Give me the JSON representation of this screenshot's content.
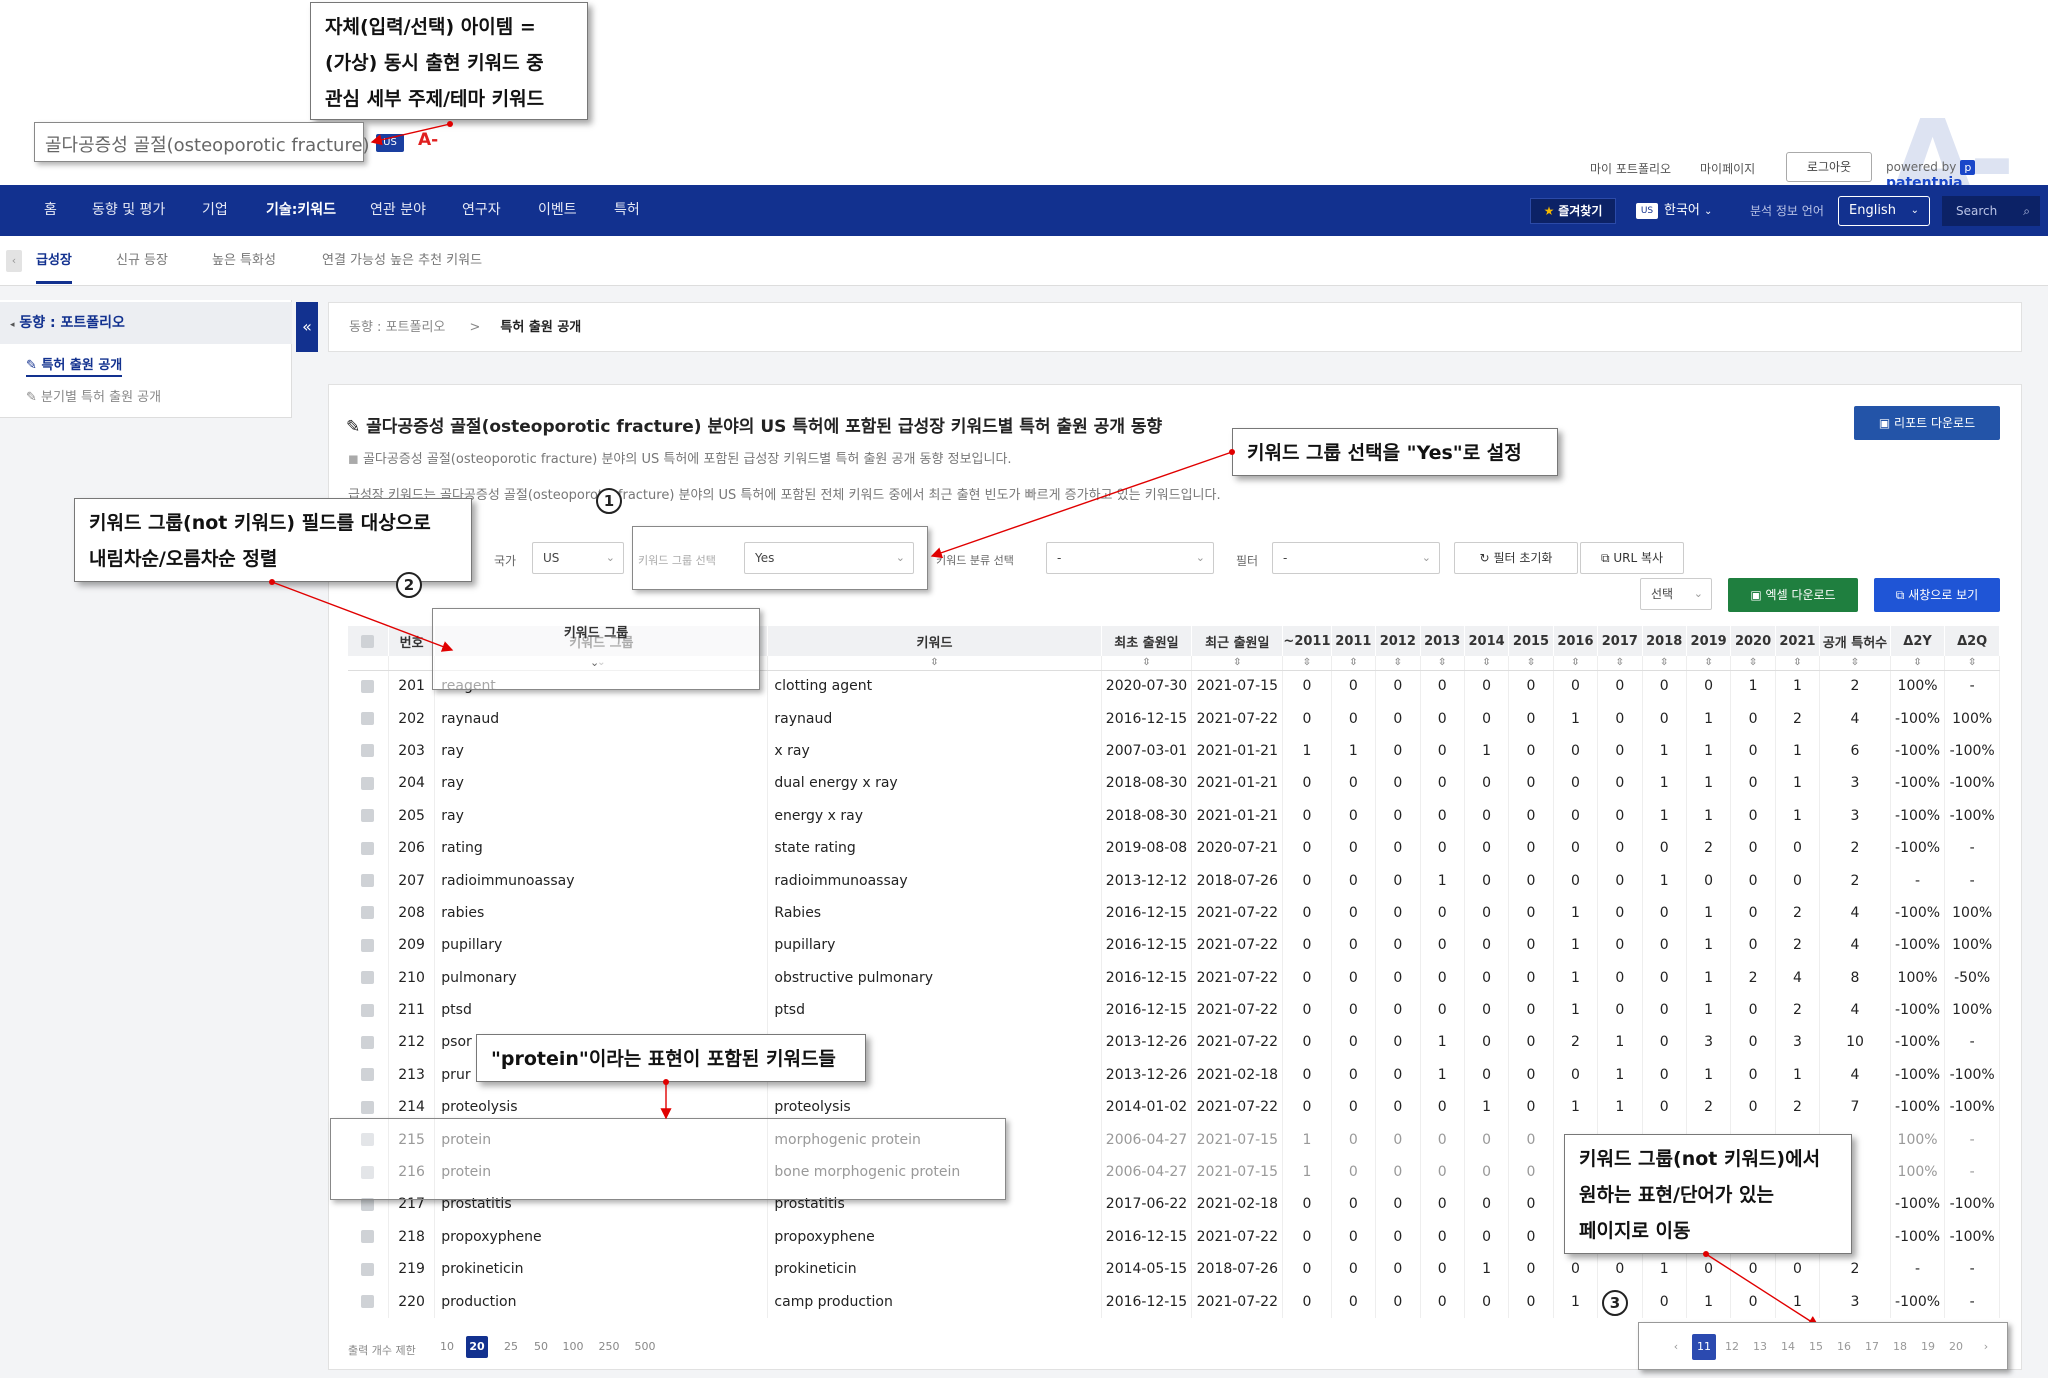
{
  "keyword": "골다공증성 골절(osteoporotic fracture)",
  "country_badge": "US",
  "a_mark": "A-",
  "big_logo": "A-",
  "callouts": {
    "c1": [
      "자체(입력/선택) 아이템 =",
      "(가상) 동시 출현 키워드 중",
      "관심 세부 주제/테마 키워드"
    ],
    "c2": "키워드 그룹 선택을 \"Yes\"로 설정",
    "c3": [
      "키워드 그룹(not 키워드) 필드를 대상으로",
      "내림차순/오름차순 정렬"
    ],
    "c4": "\"protein\"이라는 표현이 포함된 키워드들",
    "c5": [
      "키워드 그룹(not 키워드)에서",
      "원하는 표현/단어가 있는",
      "페이지로 이동"
    ]
  },
  "markers": [
    "1",
    "2",
    "3"
  ],
  "toplinks": [
    "마이 포트폴리오",
    "마이페이지"
  ],
  "logout": "로그아웃",
  "powered": "powered by",
  "brand": "patentpia",
  "brand_icon": "p",
  "nav": [
    "홈",
    "동향 및 평가",
    "기업",
    "기술:키워드",
    "연관 분야",
    "연구자",
    "이벤트",
    "특허"
  ],
  "nav_right": {
    "favorites": "즐겨찾기",
    "us": "US",
    "lang": "한국어",
    "analysis_lang_label": "분석 정보 언어",
    "analysis_lang": "English",
    "search_placeholder": "Search"
  },
  "subtabs": [
    "급성장",
    "신규 등장",
    "높은 특화성",
    "연결 가능성 높은 추천 키워드"
  ],
  "sidebar": {
    "head": "동향 : 포트폴리오",
    "items": [
      "특허 출원 공개",
      "분기별 특허 출원 공개"
    ]
  },
  "breadcrumb": {
    "parent": "동향 : 포트폴리오",
    "sep": ">",
    "current": "특허 출원 공개"
  },
  "content": {
    "title": "골다공증성 골절(osteoporotic fracture) 분야의 US 특허에 포함된 급성장 키워드별 특허 출원 공개 동향",
    "desc1": "골다공증성 골절(osteoporotic fracture) 분야의 US 특허에 포함된 급성장 키워드별 특허 출원 공개 동향 정보입니다.",
    "desc2": "급성장 키워드는 골다공증성 골절(osteoporotic fracture) 분야의 US 특허에 포함된 전체 키워드 중에서 최근 출현 빈도가 빠르게 증가하고 있는 키워드입니다.",
    "report_btn": "리포트 다운로드"
  },
  "filters": {
    "country_label": "국가",
    "country": "US",
    "group_label": "키워드 그룹 선택",
    "group": "Yes",
    "class_label": "키워드 분류 선택",
    "class": "-",
    "filter_label": "필터",
    "filter": "-",
    "reset": "필터 초기화",
    "url": "URL 복사",
    "select": "선택",
    "excel": "엑셀 다운로드",
    "newwin": "새창으로 보기"
  },
  "table": {
    "headers": [
      "번호",
      "키워드 그룹",
      "키워드",
      "최초 출원일",
      "최근 출원일",
      "~2011",
      "2011",
      "2012",
      "2013",
      "2014",
      "2015",
      "2016",
      "2017",
      "2018",
      "2019",
      "2020",
      "2021",
      "공개 특허수",
      "Δ2Y",
      "Δ2Q"
    ],
    "rows": [
      [
        "201",
        "reagent",
        "clotting agent",
        "2020-07-30",
        "2021-07-15",
        "0",
        "0",
        "0",
        "0",
        "0",
        "0",
        "0",
        "0",
        "0",
        "0",
        "1",
        "1",
        "2",
        "100%",
        "-"
      ],
      [
        "202",
        "raynaud",
        "raynaud",
        "2016-12-15",
        "2021-07-22",
        "0",
        "0",
        "0",
        "0",
        "0",
        "0",
        "1",
        "0",
        "0",
        "1",
        "0",
        "2",
        "4",
        "-100%",
        "100%"
      ],
      [
        "203",
        "ray",
        "x ray",
        "2007-03-01",
        "2021-01-21",
        "1",
        "1",
        "0",
        "0",
        "1",
        "0",
        "0",
        "0",
        "1",
        "1",
        "0",
        "1",
        "6",
        "-100%",
        "-100%"
      ],
      [
        "204",
        "ray",
        "dual energy x ray",
        "2018-08-30",
        "2021-01-21",
        "0",
        "0",
        "0",
        "0",
        "0",
        "0",
        "0",
        "0",
        "1",
        "1",
        "0",
        "1",
        "3",
        "-100%",
        "-100%"
      ],
      [
        "205",
        "ray",
        "energy x ray",
        "2018-08-30",
        "2021-01-21",
        "0",
        "0",
        "0",
        "0",
        "0",
        "0",
        "0",
        "0",
        "1",
        "1",
        "0",
        "1",
        "3",
        "-100%",
        "-100%"
      ],
      [
        "206",
        "rating",
        "state rating",
        "2019-08-08",
        "2020-07-21",
        "0",
        "0",
        "0",
        "0",
        "0",
        "0",
        "0",
        "0",
        "0",
        "2",
        "0",
        "0",
        "2",
        "-100%",
        "-"
      ],
      [
        "207",
        "radioimmunoassay",
        "radioimmunoassay",
        "2013-12-12",
        "2018-07-26",
        "0",
        "0",
        "0",
        "1",
        "0",
        "0",
        "0",
        "0",
        "1",
        "0",
        "0",
        "0",
        "2",
        "-",
        "-"
      ],
      [
        "208",
        "rabies",
        "Rabies",
        "2016-12-15",
        "2021-07-22",
        "0",
        "0",
        "0",
        "0",
        "0",
        "0",
        "1",
        "0",
        "0",
        "1",
        "0",
        "2",
        "4",
        "-100%",
        "100%"
      ],
      [
        "209",
        "pupillary",
        "pupillary",
        "2016-12-15",
        "2021-07-22",
        "0",
        "0",
        "0",
        "0",
        "0",
        "0",
        "1",
        "0",
        "0",
        "1",
        "0",
        "2",
        "4",
        "-100%",
        "100%"
      ],
      [
        "210",
        "pulmonary",
        "obstructive pulmonary",
        "2016-12-15",
        "2021-07-22",
        "0",
        "0",
        "0",
        "0",
        "0",
        "0",
        "1",
        "0",
        "0",
        "1",
        "2",
        "4",
        "8",
        "100%",
        "-50%"
      ],
      [
        "211",
        "ptsd",
        "ptsd",
        "2016-12-15",
        "2021-07-22",
        "0",
        "0",
        "0",
        "0",
        "0",
        "0",
        "1",
        "0",
        "0",
        "1",
        "0",
        "2",
        "4",
        "-100%",
        "100%"
      ],
      [
        "212",
        "psor",
        "",
        "2013-12-26",
        "2021-07-22",
        "0",
        "0",
        "0",
        "1",
        "0",
        "0",
        "2",
        "1",
        "0",
        "3",
        "0",
        "3",
        "10",
        "-100%",
        "-"
      ],
      [
        "213",
        "prur",
        "",
        "2013-12-26",
        "2021-02-18",
        "0",
        "0",
        "0",
        "1",
        "0",
        "0",
        "0",
        "1",
        "0",
        "1",
        "0",
        "1",
        "4",
        "-100%",
        "-100%"
      ],
      [
        "214",
        "proteolysis",
        "proteolysis",
        "2014-01-02",
        "2021-07-22",
        "0",
        "0",
        "0",
        "0",
        "1",
        "0",
        "1",
        "1",
        "0",
        "2",
        "0",
        "2",
        "7",
        "-100%",
        "-100%"
      ],
      [
        "215",
        "protein",
        "morphogenic protein",
        "2006-04-27",
        "2021-07-15",
        "1",
        "0",
        "0",
        "0",
        "0",
        "0",
        "",
        "",
        "",
        "",
        "",
        "",
        "",
        "100%",
        "-"
      ],
      [
        "216",
        "protein",
        "bone morphogenic protein",
        "2006-04-27",
        "2021-07-15",
        "1",
        "0",
        "0",
        "0",
        "0",
        "0",
        "",
        "",
        "",
        "",
        "",
        "",
        "",
        "100%",
        "-"
      ],
      [
        "217",
        "prostatitis",
        "prostatitis",
        "2017-06-22",
        "2021-02-18",
        "0",
        "0",
        "0",
        "0",
        "0",
        "0",
        "",
        "",
        "",
        "",
        "",
        "",
        "",
        "-100%",
        "-100%"
      ],
      [
        "218",
        "propoxyphene",
        "propoxyphene",
        "2016-12-15",
        "2021-07-22",
        "0",
        "0",
        "0",
        "0",
        "0",
        "0",
        "",
        "",
        "",
        "",
        "",
        "",
        "",
        "-100%",
        "-100%"
      ],
      [
        "219",
        "prokineticin",
        "prokineticin",
        "2014-05-15",
        "2018-07-26",
        "0",
        "0",
        "0",
        "0",
        "1",
        "0",
        "0",
        "0",
        "1",
        "0",
        "0",
        "0",
        "2",
        "-",
        "-"
      ],
      [
        "220",
        "production",
        "camp production",
        "2016-12-15",
        "2021-07-22",
        "0",
        "0",
        "0",
        "0",
        "0",
        "0",
        "1",
        "",
        "0",
        "1",
        "0",
        "1",
        "3",
        "-100%",
        "-"
      ]
    ]
  },
  "page_size": {
    "label": "출력 개수 제한",
    "options": [
      "10",
      "20",
      "25",
      "50",
      "100",
      "250",
      "500"
    ],
    "selected": "20"
  },
  "pagination": {
    "prev": "‹",
    "pages": [
      "11",
      "12",
      "13",
      "14",
      "15",
      "16",
      "17",
      "18",
      "19",
      "20"
    ],
    "current": "11",
    "next": "›"
  }
}
